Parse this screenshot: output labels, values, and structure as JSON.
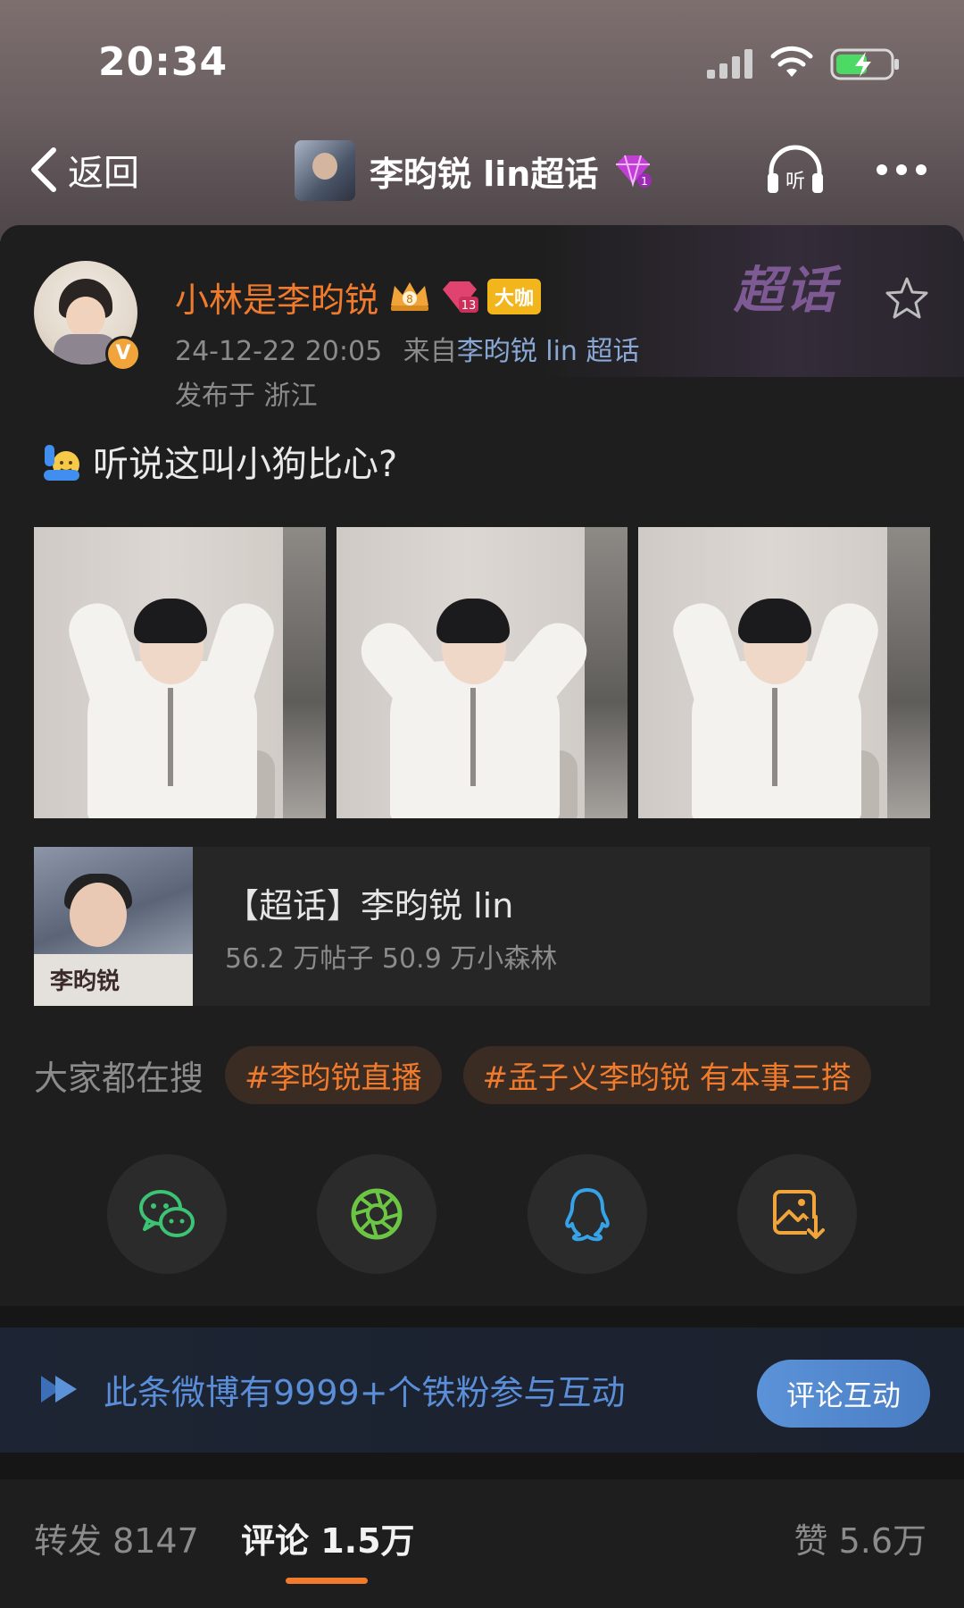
{
  "status_bar": {
    "time": "20:34"
  },
  "nav": {
    "back_label": "返回",
    "title": "李昀锐 lin超话"
  },
  "card": {
    "deco_text": "超话"
  },
  "post": {
    "username": "小林是李昀锐",
    "crown_level": "8",
    "fan_level": "13",
    "badge": "大咖",
    "verified_mark": "V",
    "date": "24-12-22 20:05",
    "source_prefix": "来自",
    "source_link": "李昀锐 lin 超话",
    "location": "发布于 浙江",
    "text": "听说这叫小狗比心?"
  },
  "topic": {
    "title": "【超话】李昀锐 lin",
    "stats": "56.2 万帖子 50.9 万小森林",
    "thumb_text": "李昀锐"
  },
  "search": {
    "label": "大家都在搜",
    "tags": [
      "#李昀锐直播",
      "#孟子义李昀锐 有本事三搭"
    ]
  },
  "share": [
    "wechat-icon",
    "moments-icon",
    "qq-icon",
    "save-image-icon"
  ],
  "banner": {
    "text": "此条微博有9999+个铁粉参与互动",
    "button": "评论互动"
  },
  "tabs": {
    "repost": "转发 8147",
    "comment": "评论 1.5万",
    "like": "赞 5.6万"
  },
  "colors": {
    "accent": "#f07b2c",
    "link": "#8aa8d6",
    "banner_text": "#5a8ed8",
    "background": "#1e1e1e"
  }
}
